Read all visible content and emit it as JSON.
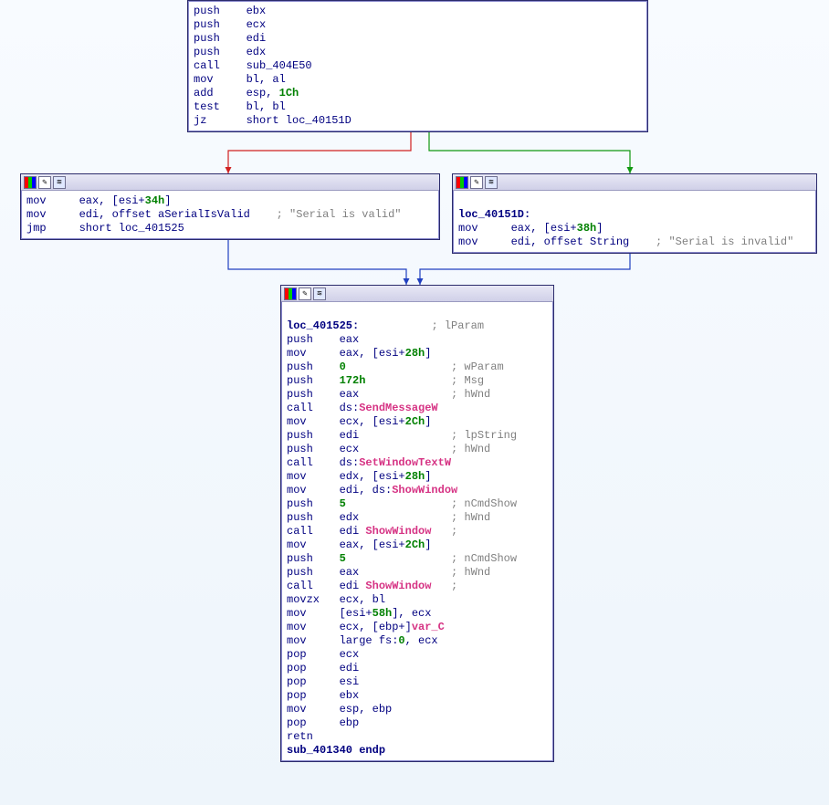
{
  "colors": {
    "edge_false": "#d02020",
    "edge_true": "#109810",
    "edge_uncond": "#2040c0"
  },
  "block_top": {
    "lines": [
      {
        "op": "push",
        "arg": "ebx"
      },
      {
        "op": "push",
        "arg": "ecx"
      },
      {
        "op": "push",
        "arg": "edi"
      },
      {
        "op": "push",
        "arg": "edx"
      },
      {
        "op": "call",
        "arg": "sub_404E50"
      },
      {
        "op": "mov",
        "arg": "bl, al"
      },
      {
        "op": "add",
        "arg": "esp, ",
        "num": "1Ch"
      },
      {
        "op": "test",
        "arg": "bl, bl"
      },
      {
        "op": "jz",
        "arg": "short loc_40151D"
      }
    ]
  },
  "block_left": {
    "lines": [
      {
        "op": "mov",
        "arg": "eax, [esi+",
        "num": "34h",
        "arg2": "]"
      },
      {
        "op": "mov",
        "arg": "edi, offset aSerialIsValid ",
        "cmt": "; \"Serial is valid\""
      },
      {
        "op": "jmp",
        "arg": "short loc_401525"
      }
    ]
  },
  "block_right": {
    "label": "loc_40151D:",
    "lines": [
      {
        "op": "mov",
        "arg": "eax, [esi+",
        "num": "38h",
        "arg2": "]"
      },
      {
        "op": "mov",
        "arg": "edi, offset String ",
        "cmt": "; \"Serial is invalid\""
      }
    ]
  },
  "block_bottom": {
    "label": "loc_401525:",
    "label_cmt": "; lParam",
    "lines": [
      {
        "op": "push",
        "arg": "eax"
      },
      {
        "op": "mov",
        "arg": "eax, [esi+",
        "num": "28h",
        "arg2": "]"
      },
      {
        "op": "push",
        "num": "0",
        "cmt": "; wParam"
      },
      {
        "op": "push",
        "num": "172h",
        "cmt": "; Msg"
      },
      {
        "op": "push",
        "arg": "eax",
        "cmt": "; hWnd"
      },
      {
        "op": "call",
        "arg": "ds:",
        "api": "SendMessageW"
      },
      {
        "op": "mov",
        "arg": "ecx, [esi+",
        "num": "2Ch",
        "arg2": "]"
      },
      {
        "op": "push",
        "arg": "edi",
        "cmt": "; lpString"
      },
      {
        "op": "push",
        "arg": "ecx",
        "cmt": "; hWnd"
      },
      {
        "op": "call",
        "arg": "ds:",
        "api": "SetWindowTextW"
      },
      {
        "op": "mov",
        "arg": "edx, [esi+",
        "num": "28h",
        "arg2": "]"
      },
      {
        "op": "mov",
        "arg": "edi, ds:",
        "api": "ShowWindow"
      },
      {
        "op": "push",
        "num": "5",
        "cmt": "; nCmdShow"
      },
      {
        "op": "push",
        "arg": "edx",
        "cmt": "; hWnd"
      },
      {
        "op": "call",
        "arg": "edi ",
        "cmt2": "; ",
        "api": "ShowWindow"
      },
      {
        "op": "mov",
        "arg": "eax, [esi+",
        "num": "2Ch",
        "arg2": "]"
      },
      {
        "op": "push",
        "num": "5",
        "cmt": "; nCmdShow"
      },
      {
        "op": "push",
        "arg": "eax",
        "cmt": "; hWnd"
      },
      {
        "op": "call",
        "arg": "edi ",
        "cmt2": "; ",
        "api": "ShowWindow"
      },
      {
        "op": "movzx",
        "arg": "ecx, bl"
      },
      {
        "op": "mov",
        "arg": "[esi+",
        "num": "58h",
        "arg2": "], ecx"
      },
      {
        "op": "mov",
        "arg": "ecx, [ebp+",
        "api": "var_C",
        "arg2": "]"
      },
      {
        "op": "mov",
        "arg": "large fs:",
        "num": "0",
        "arg2": ", ecx"
      },
      {
        "op": "pop",
        "arg": "ecx"
      },
      {
        "op": "pop",
        "arg": "edi"
      },
      {
        "op": "pop",
        "arg": "esi"
      },
      {
        "op": "pop",
        "arg": "ebx"
      },
      {
        "op": "mov",
        "arg": "esp, ebp"
      },
      {
        "op": "pop",
        "arg": "ebp"
      },
      {
        "op": "retn"
      }
    ],
    "endp": "sub_401340 endp"
  }
}
